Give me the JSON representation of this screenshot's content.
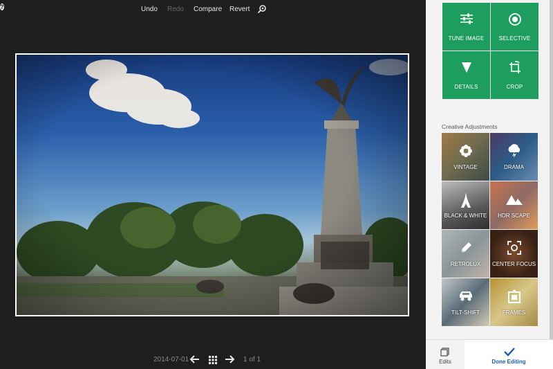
{
  "toolbar": {
    "undo": "Undo",
    "redo": "Redo",
    "compare": "Compare",
    "revert": "Revert",
    "help": "?"
  },
  "bottom_nav": {
    "date": "2014-07-01",
    "count": "1 of 1"
  },
  "tools": [
    {
      "label": "TUNE IMAGE",
      "icon": "sliders-icon"
    },
    {
      "label": "SELECTIVE",
      "icon": "target-icon"
    },
    {
      "label": "DETAILS",
      "icon": "triangle-down-icon"
    },
    {
      "label": "CROP",
      "icon": "crop-rotate-icon"
    }
  ],
  "creative_heading": "Creative Adjustments",
  "filters": [
    {
      "label": "VINTAGE",
      "icon": "flower-icon"
    },
    {
      "label": "DRAMA",
      "icon": "cloud-lightning-icon"
    },
    {
      "label": "BLACK & WHITE",
      "icon": "eiffel-tower-icon"
    },
    {
      "label": "HDR SCAPE",
      "icon": "mountains-icon"
    },
    {
      "label": "RETROLUX",
      "icon": "pen-icon"
    },
    {
      "label": "CENTER FOCUS",
      "icon": "focus-icon"
    },
    {
      "label": "TILT-SHIFT",
      "icon": "car-icon"
    },
    {
      "label": "FRAMES",
      "icon": "frame-icon"
    }
  ],
  "footer": {
    "edits": "Edits",
    "done": "Done Editing"
  },
  "colors": {
    "accent_green": "#1e9e5e",
    "done_blue": "#1a5fb4",
    "background_dark": "#1f1f1f"
  }
}
